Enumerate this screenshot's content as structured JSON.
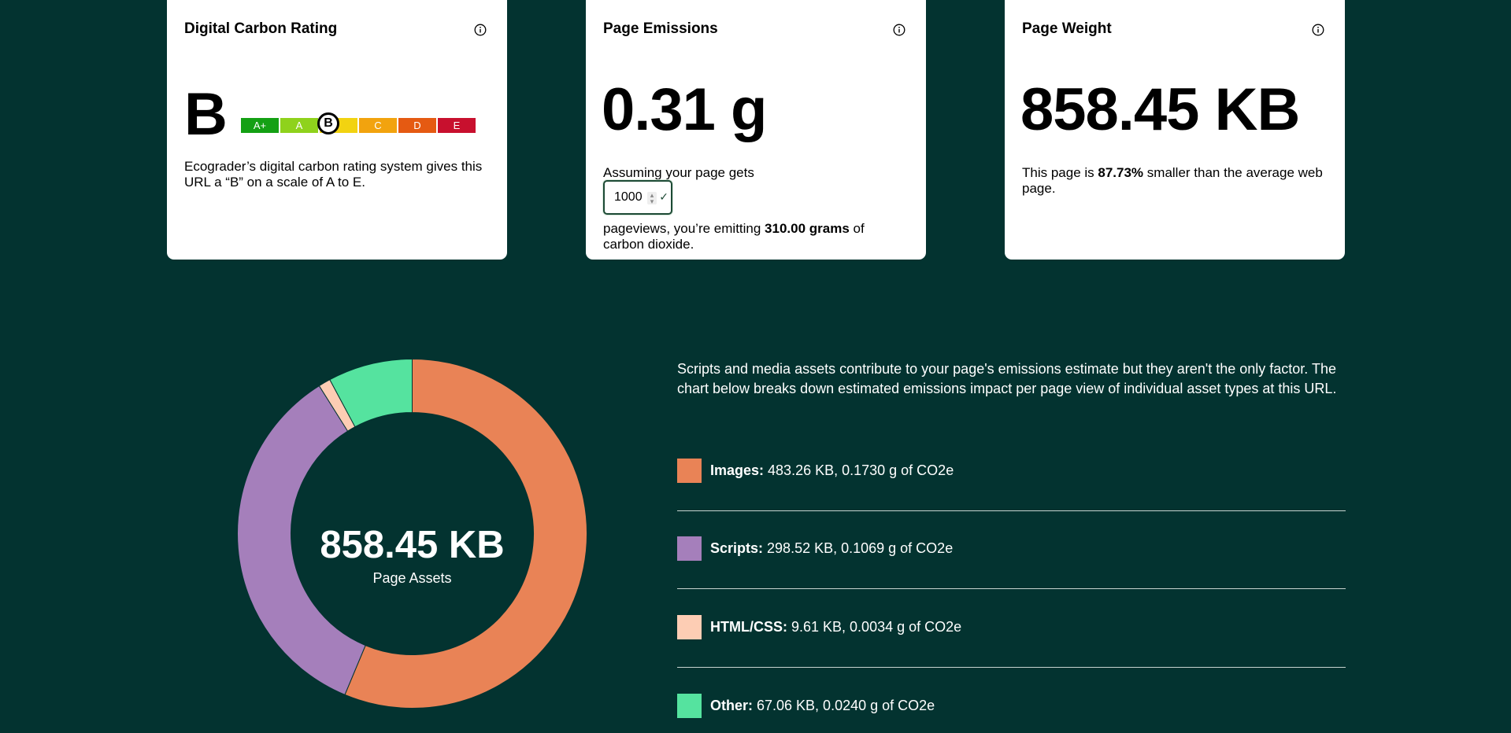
{
  "cards": {
    "rating": {
      "title": "Digital Carbon Rating",
      "grade": "B",
      "scale": [
        {
          "label": "A+",
          "color": "#14a014"
        },
        {
          "label": "A",
          "color": "#8fd21c"
        },
        {
          "label": "B",
          "color": "#f2d311"
        },
        {
          "label": "C",
          "color": "#f2a30e"
        },
        {
          "label": "D",
          "color": "#e55a12"
        },
        {
          "label": "E",
          "color": "#c8102e"
        }
      ],
      "description": "Ecograder’s digital carbon rating system gives this URL a “B” on a scale of A to E."
    },
    "emissions": {
      "title": "Page Emissions",
      "value": "0.31 g",
      "text_before": "Assuming your page gets",
      "pageviews": "1000",
      "text_after_prefix": "pageviews, you’re emitting ",
      "text_after_bold": "310.00 grams",
      "text_after_suffix": " of carbon dioxide."
    },
    "weight": {
      "title": "Page Weight",
      "value": "858.45 KB",
      "text_prefix": "This page is ",
      "text_bold": "87.73%",
      "text_suffix": " smaller than the average web page."
    }
  },
  "assets": {
    "total_value": "858.45 KB",
    "total_label": "Page Assets",
    "intro": "Scripts and media assets contribute to your page's emissions estimate but they aren't the only factor. The chart below breaks down estimated emissions impact per page view of individual asset types at this URL.",
    "items": [
      {
        "name": "Images:",
        "detail": "483.26 KB, 0.1730 g of CO2e",
        "color": "#e98356"
      },
      {
        "name": "Scripts:",
        "detail": "298.52 KB, 0.1069 g of CO2e",
        "color": "#a57fbb"
      },
      {
        "name": "HTML/CSS:",
        "detail": "9.61 KB, 0.0034 g of CO2e",
        "color": "#fdcdb4"
      },
      {
        "name": "Other:",
        "detail": "67.06 KB, 0.0240 g of CO2e",
        "color": "#55e39f"
      }
    ]
  },
  "chart_data": {
    "type": "pie",
    "categories": [
      "Images",
      "Scripts",
      "HTML/CSS",
      "Other"
    ],
    "values": [
      483.26,
      298.52,
      9.61,
      67.06
    ],
    "unit": "KB",
    "colors": [
      "#e98356",
      "#a57fbb",
      "#fdcdb4",
      "#55e39f"
    ]
  }
}
